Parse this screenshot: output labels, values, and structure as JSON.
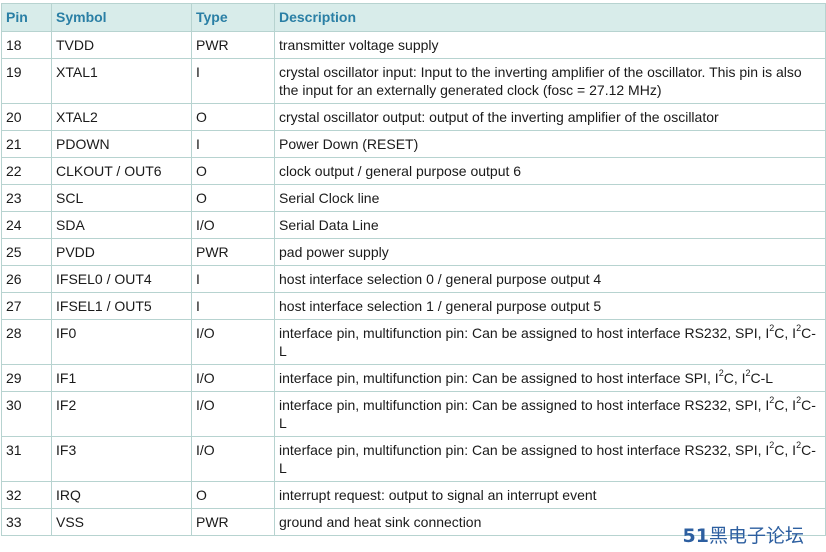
{
  "table": {
    "headers": {
      "pin": "Pin",
      "symbol": "Symbol",
      "type": "Type",
      "description": "Description"
    },
    "rows": [
      {
        "pin": "18",
        "symbol": "TVDD",
        "type": "PWR",
        "description": "transmitter voltage supply"
      },
      {
        "pin": "19",
        "symbol": "XTAL1",
        "type": "I",
        "description": "crystal oscillator input: Input to the inverting amplifier of the oscillator. This pin is also the input for an externally generated clock (fosc = 27.12 MHz)"
      },
      {
        "pin": "20",
        "symbol": "XTAL2",
        "type": "O",
        "description": "crystal oscillator output: output of the inverting amplifier of the oscillator"
      },
      {
        "pin": "21",
        "symbol": "PDOWN",
        "type": "I",
        "description": "Power Down (RESET)"
      },
      {
        "pin": "22",
        "symbol": "CLKOUT / OUT6",
        "type": "O",
        "description": "clock output / general purpose output 6"
      },
      {
        "pin": "23",
        "symbol": "SCL",
        "type": "O",
        "description": "Serial Clock line"
      },
      {
        "pin": "24",
        "symbol": "SDA",
        "type": "I/O",
        "description": "Serial Data Line"
      },
      {
        "pin": "25",
        "symbol": "PVDD",
        "type": "PWR",
        "description": "pad power supply"
      },
      {
        "pin": "26",
        "symbol": "IFSEL0 / OUT4",
        "type": "I",
        "description": "host interface selection 0 / general purpose output 4"
      },
      {
        "pin": "27",
        "symbol": "IFSEL1 / OUT5",
        "type": "I",
        "description": "host interface selection 1 / general purpose output 5"
      },
      {
        "pin": "28",
        "symbol": "IF0",
        "type": "I/O",
        "description": "interface pin, multifunction pin: Can be assigned to host interface RS232, SPI, I^2C, I^2C-L"
      },
      {
        "pin": "29",
        "symbol": "IF1",
        "type": "I/O",
        "description": "interface pin, multifunction pin: Can be assigned to host interface SPI, I^2C, I^2C-L"
      },
      {
        "pin": "30",
        "symbol": "IF2",
        "type": "I/O",
        "description": "interface pin, multifunction pin: Can be assigned to host interface RS232, SPI, I^2C, I^2C-L"
      },
      {
        "pin": "31",
        "symbol": "IF3",
        "type": "I/O",
        "description": "interface pin, multifunction pin: Can be assigned to host interface RS232, SPI, I^2C, I^2C-L"
      },
      {
        "pin": "32",
        "symbol": "IRQ",
        "type": "O",
        "description": "interrupt request: output to signal an interrupt event"
      },
      {
        "pin": "33",
        "symbol": "VSS",
        "type": "PWR",
        "description": "ground and heat sink connection"
      }
    ]
  },
  "watermark": {
    "number": "51",
    "text": "黑电子论坛"
  },
  "colors": {
    "header_bg": "#d8ecea",
    "header_text": "#2a7fa5",
    "border": "#b7d3d0",
    "watermark": "#2d5fa0"
  }
}
